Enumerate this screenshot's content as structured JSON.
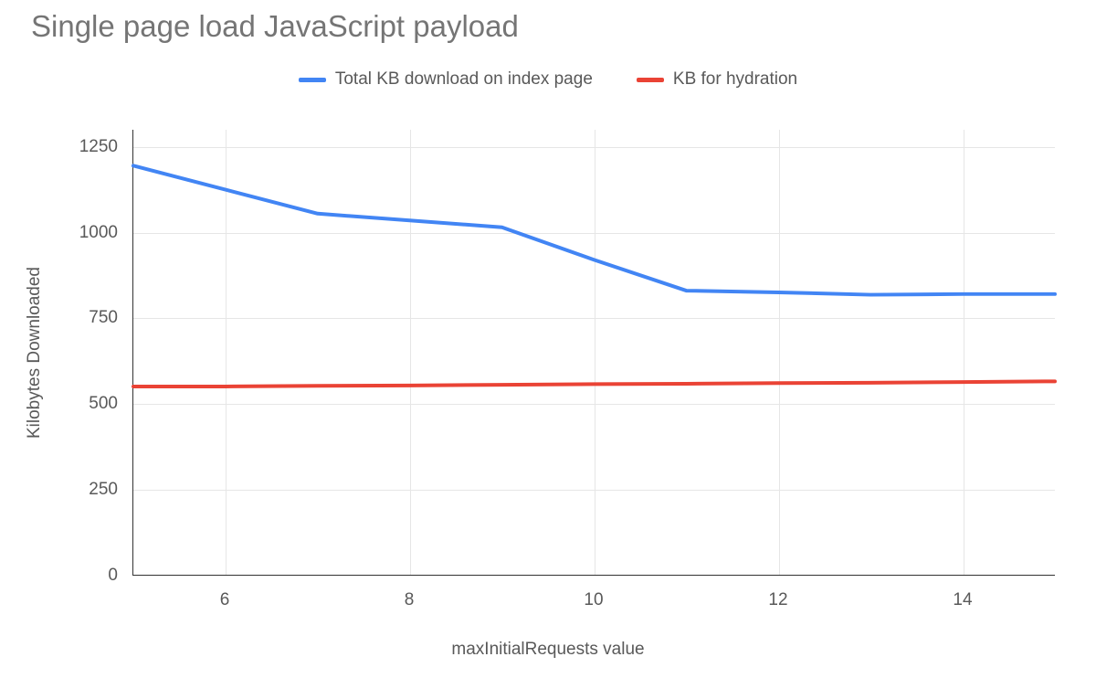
{
  "chart_data": {
    "type": "line",
    "title": "Single page load JavaScript payload",
    "xlabel": "maxInitialRequests value",
    "ylabel": "Kilobytes Downloaded",
    "x": [
      5,
      6,
      7,
      8,
      9,
      10,
      11,
      12,
      13,
      14,
      15
    ],
    "x_ticks": [
      6,
      8,
      10,
      12,
      14
    ],
    "y_ticks": [
      0,
      250,
      500,
      750,
      1000,
      1250
    ],
    "xlim": [
      5,
      15
    ],
    "ylim": [
      0,
      1300
    ],
    "series": [
      {
        "name": "Total KB download on index page",
        "color": "#4285f4",
        "values": [
          1195,
          1125,
          1055,
          1035,
          1015,
          920,
          830,
          825,
          818,
          820,
          820
        ]
      },
      {
        "name": "KB for hydration",
        "color": "#ea4335",
        "values": [
          550,
          550,
          552,
          553,
          555,
          557,
          558,
          560,
          561,
          563,
          565
        ]
      }
    ],
    "legend_position": "top"
  }
}
